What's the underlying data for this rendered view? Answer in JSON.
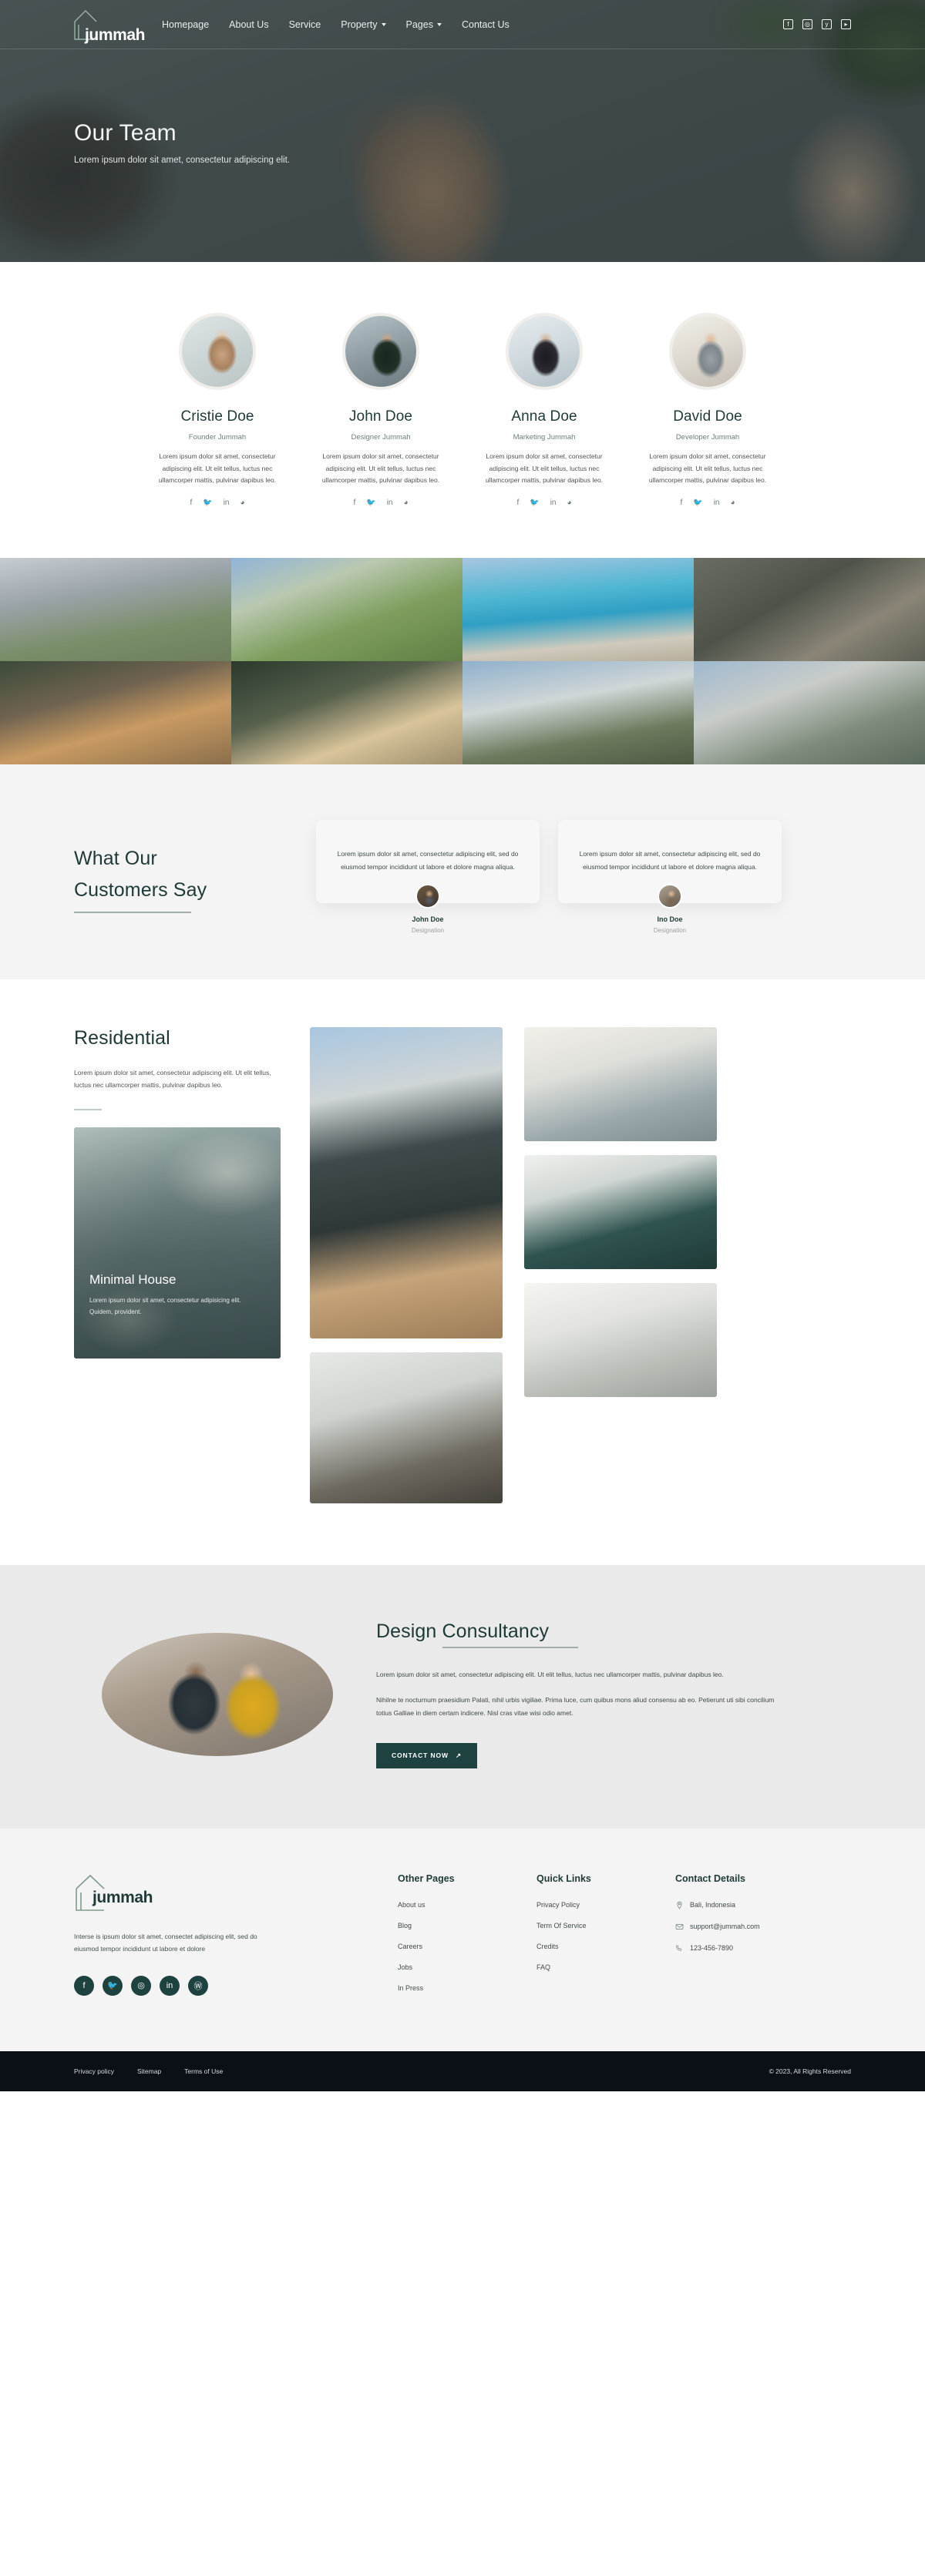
{
  "brand": {
    "name": "jummah",
    "logo_icon": "house-outline-icon"
  },
  "nav": {
    "items": [
      {
        "label": "Homepage",
        "has_dropdown": false
      },
      {
        "label": "About Us",
        "has_dropdown": false
      },
      {
        "label": "Service",
        "has_dropdown": false
      },
      {
        "label": "Property",
        "has_dropdown": true
      },
      {
        "label": "Pages",
        "has_dropdown": true
      },
      {
        "label": "Contact Us",
        "has_dropdown": false
      }
    ],
    "social": [
      "facebook-icon",
      "instagram-icon",
      "twitter-icon",
      "youtube-icon"
    ]
  },
  "hero": {
    "title": "Our Team",
    "subtitle": "Lorem ipsum dolor sit amet, consectetur adipiscing elit."
  },
  "team": {
    "bio": "Lorem ipsum dolor sit amet, consectetur adipiscing elit. Ut elit tellus, luctus nec ullamcorper mattis, pulvinar dapibus leo.",
    "social": [
      "facebook-icon",
      "twitter-icon",
      "linkedin-icon",
      "whatsapp-icon"
    ],
    "members": [
      {
        "name": "Cristie Doe",
        "role": "Founder Jummah"
      },
      {
        "name": "John Doe",
        "role": "Designer Jummah"
      },
      {
        "name": "Anna Doe",
        "role": "Marketing Jummah"
      },
      {
        "name": "David Doe",
        "role": "Developer Jummah"
      }
    ]
  },
  "gallery": {
    "items": [
      {
        "alt": "modern-white-house"
      },
      {
        "alt": "house-with-lawn"
      },
      {
        "alt": "villa-with-pool"
      },
      {
        "alt": "dark-concrete-house"
      },
      {
        "alt": "warm-lit-wooden-house"
      },
      {
        "alt": "night-modern-house"
      },
      {
        "alt": "white-cube-house"
      },
      {
        "alt": "glass-facade-house"
      }
    ]
  },
  "testimonials": {
    "heading_line1": "What Our",
    "heading_line2": "Customers Say",
    "cards": [
      {
        "quote": "Lorem ipsum dolor sit amet, consectetur adipiscing elit, sed do eiusmod tempor incididunt ut labore et dolore magna aliqua.",
        "name": "John Doe",
        "role": "Designation"
      },
      {
        "quote": "Lorem ipsum dolor sit amet, consectetur adipiscing elit, sed do eiusmod tempor incididunt ut labore et dolore magna aliqua.",
        "name": "Ino Doe",
        "role": "Designation"
      }
    ]
  },
  "residential": {
    "title": "Residential",
    "description": "Lorem ipsum dolor sit amet, consectetur adipiscing elit. Ut elit tellus, luctus nec ullamcorper mattis, pulvinar dapibus leo.",
    "promo": {
      "title": "Minimal House",
      "text": "Lorem ipsum dolor sit amet, consectetur adipisicing elit. Quidem, provident."
    },
    "images": [
      {
        "alt": "modern-house-exterior-large"
      },
      {
        "alt": "living-room-with-sofa"
      },
      {
        "alt": "green-sofa-living-room"
      },
      {
        "alt": "bright-living-room-plants"
      },
      {
        "alt": "glass-door-interior"
      }
    ]
  },
  "consultancy": {
    "title": "Design Consultancy",
    "paragraph1": "Lorem ipsum dolor sit amet, consectetur adipiscing elit. Ut elit tellus, luctus nec ullamcorper mattis, pulvinar dapibus leo.",
    "paragraph2": "Nihilne te nocturnum praesidium Palati, nihil urbis vigiliae. Prima luce, cum quibus mons aliud consensu ab eo. Petierunt uti sibi concilium totius Galliae in diem certam indicere. Nisl cras vitae wisi odio amet.",
    "button_label": "CONTACT NOW",
    "button_icon": "arrow-up-right-icon",
    "image_alt": "two-people-at-desk",
    "accent": "#1e4240"
  },
  "footer": {
    "description": "Interse is ipsum dolor sit amet, consectet adipiscing elit, sed do eiusmod tempor incididunt ut labore et dolore",
    "social": [
      "facebook-icon",
      "twitter-icon",
      "instagram-icon",
      "linkedin-icon",
      "wordpress-icon"
    ],
    "columns": [
      {
        "title": "Other Pages",
        "links": [
          "About us",
          "Blog",
          "Careers",
          "Jobs",
          "In Press"
        ]
      },
      {
        "title": "Quick Links",
        "links": [
          "Privacy Policy",
          "Term Of Service",
          "Credits",
          "FAQ"
        ]
      }
    ],
    "contact": {
      "title": "Contact Details",
      "rows": [
        {
          "icon": "location-pin-icon",
          "text": "Bali, Indonesia"
        },
        {
          "icon": "envelope-icon",
          "text": "support@jummah.com"
        },
        {
          "icon": "phone-icon",
          "text": "123-456-7890"
        }
      ]
    }
  },
  "bottombar": {
    "links": [
      "Privacy policy",
      "Sitemap",
      "Terms of Use"
    ],
    "copyright": "© 2023, All Rights Reserved"
  }
}
